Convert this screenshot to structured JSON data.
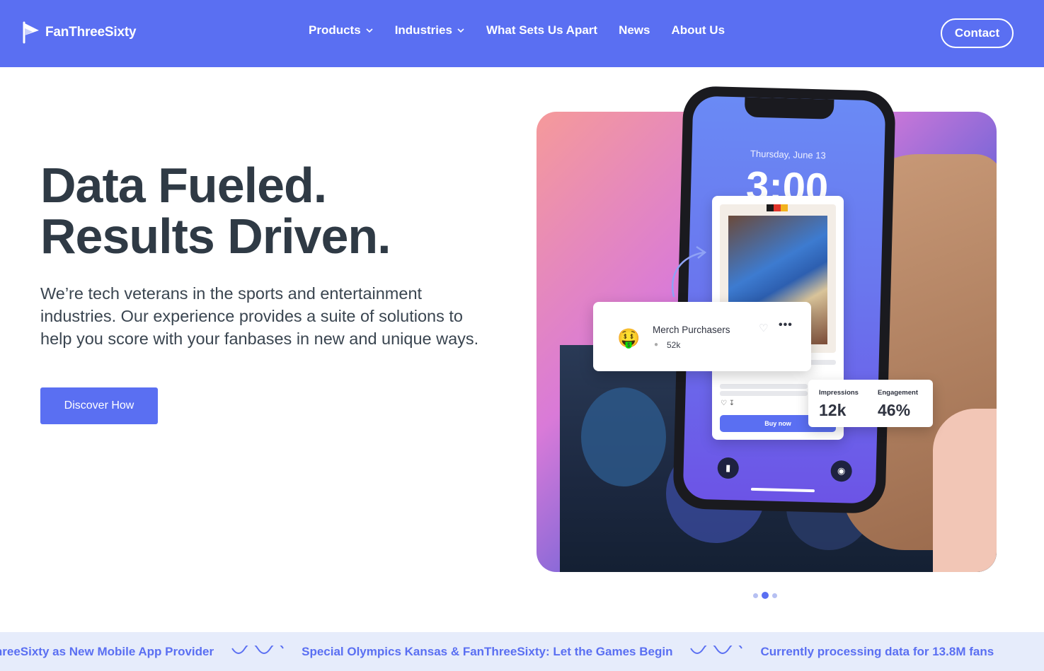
{
  "brand": {
    "name": "FanThreeSixty",
    "color": "#5a6ff2"
  },
  "nav": {
    "items": [
      {
        "label": "Products",
        "dropdown": true
      },
      {
        "label": "Industries",
        "dropdown": true
      },
      {
        "label": "What Sets Us Apart",
        "dropdown": false
      },
      {
        "label": "News",
        "dropdown": false
      },
      {
        "label": "About Us",
        "dropdown": false
      }
    ],
    "contact_label": "Contact"
  },
  "hero": {
    "title_line1": "Data Fueled.",
    "title_line2": "Results Driven.",
    "subtitle": "We’re tech veterans in the sports and entertainment industries. Our experience provides a suite of solutions to help you score with your fanbases in new and unique ways.",
    "cta_label": "Discover How"
  },
  "phone": {
    "date": "Thursday, June 13",
    "time": "3:00",
    "buy_label": "Buy now"
  },
  "merch_card": {
    "emoji": "🤑",
    "title": "Merch Purchasers",
    "count": "52k"
  },
  "stats": {
    "impressions_label": "Impressions",
    "impressions_value": "12k",
    "engagement_label": "Engagement",
    "engagement_value": "46%"
  },
  "carousel": {
    "count": 3,
    "active": 1
  },
  "ticker": {
    "items": [
      "Selects FanThreeSixty as New Mobile App Provider",
      "Special Olympics Kansas & FanThreeSixty: Let the Games Begin",
      "Currently processing data for 13.8M fans"
    ]
  }
}
